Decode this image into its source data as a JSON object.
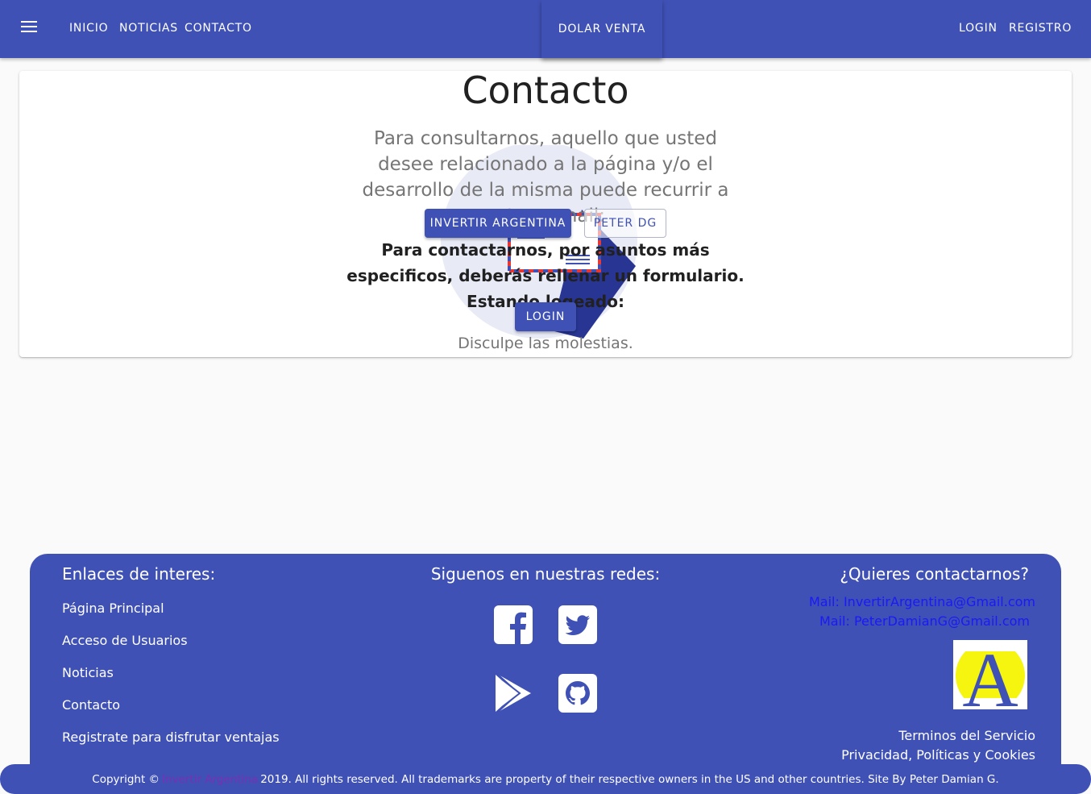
{
  "colors": {
    "primary": "#3f51b5",
    "mail_link": "#1a1af5",
    "brand_link": "#7b2fb3"
  },
  "nav": {
    "menu_icon": "hamburger-menu-icon",
    "links": [
      "INICIO",
      "NOTICIAS",
      "CONTACTO"
    ],
    "dolar": "DOLAR VENTA",
    "login": "LOGIN",
    "register": "REGISTRO"
  },
  "contact": {
    "title": "Contacto",
    "description": "Para consultarnos, aquello que usted desee relacionado a la página y/o el desarrollo de la misma puede recurrir a estos e-mail:",
    "btn_invertir": "INVERTIR ARGENTINA",
    "btn_peter": "PETER DG",
    "forms_text": "Para contactarnos, por asuntos más especificos, deberás rellenar un formulario. Estando logeado:",
    "btn_login": "LOGIN",
    "sorry": "Disculpe las molestias."
  },
  "footer": {
    "links_title": "Enlaces de interes:",
    "links": [
      "Página Principal",
      "Acceso de Usuarios",
      "Noticias",
      "Contacto",
      "Registrate para disfrutar ventajas"
    ],
    "social_title": "Siguenos en nuestras redes:",
    "social_icons": [
      "facebook-icon",
      "twitter-icon",
      "google-play-icon",
      "github-icon"
    ],
    "contact_title": "¿Quieres contactarnos?",
    "mail1": "Mail: InvertirArgentina@Gmail.com",
    "mail2": "Mail: PeterDamianG@Gmail.com",
    "logo_letter": "A",
    "terms": "Terminos del Servicio",
    "privacy": "Privacidad, Políticas y Cookies"
  },
  "copyright": {
    "prefix": "Copyright ©",
    "brand": "Invertir Argentina",
    "suffix": "2019. All rights reserved. All trademarks are property of their respective owners in the US and other countries. Site By Peter Damian G."
  }
}
